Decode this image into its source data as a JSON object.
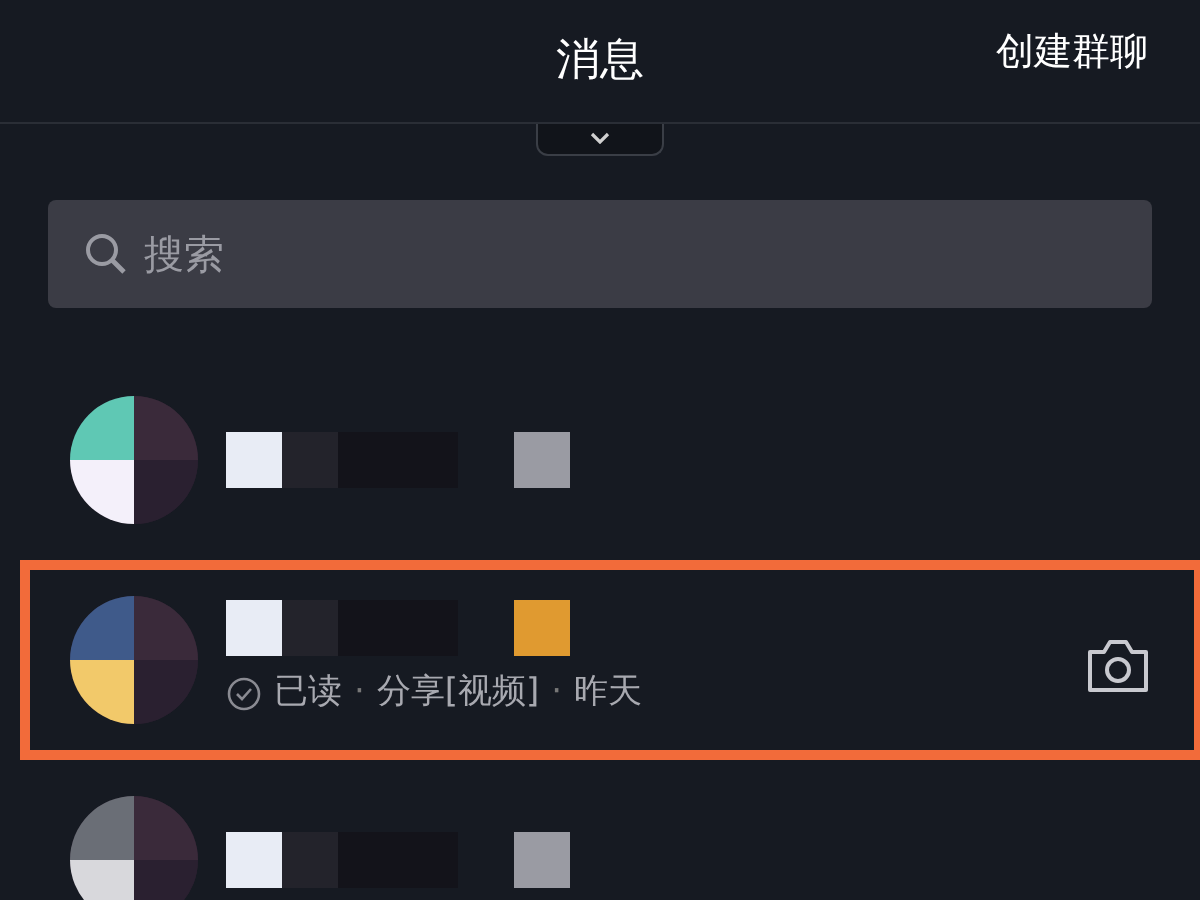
{
  "header": {
    "title": "消息",
    "action": "创建群聊"
  },
  "search": {
    "placeholder": "搜索"
  },
  "conversations": [
    {
      "highlighted": false
    },
    {
      "highlighted": true,
      "read": true,
      "read_label": "已读",
      "preview": "分享[视频]",
      "time": "昨天",
      "separators": [
        "·",
        "·"
      ]
    },
    {
      "highlighted": false
    }
  ]
}
